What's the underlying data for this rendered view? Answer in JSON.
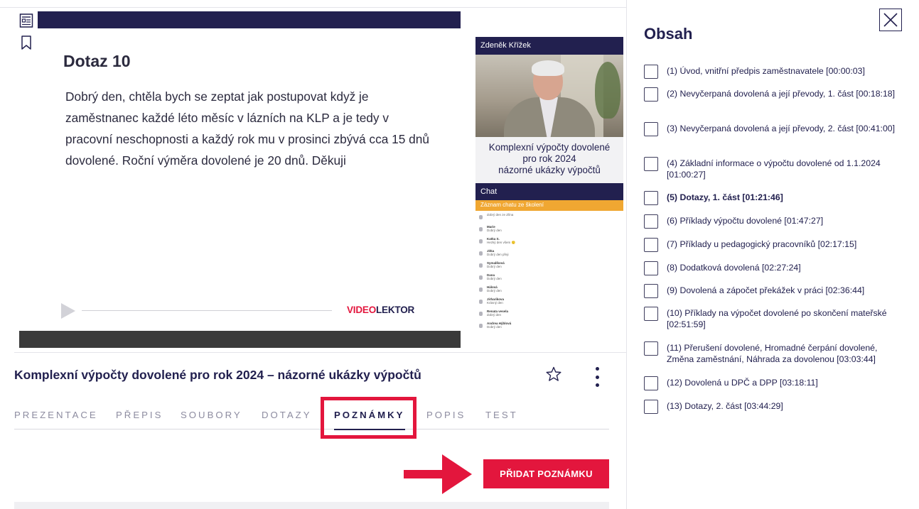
{
  "colors": {
    "brand_navy": "#22204f",
    "accent_red": "#e3163d",
    "chat_orange": "#f0a732"
  },
  "rail": {
    "icons": [
      "transcript-icon",
      "bookmark-icon"
    ]
  },
  "player": {
    "slide_title": "Dotaz 10",
    "slide_text": "Dobrý den, chtěla bych se zeptat jak postupovat když je zaměstnanec každé léto měsíc v lázních na KLP a je tedy v pracovní neschopnosti a každý rok mu v prosinci zbývá cca 15 dnů dovolené. Roční výměra dovolené je 20 dnů. Děkuji",
    "logo_part1": "VIDEO",
    "logo_part2": "LEKTOR",
    "speaker_name": "Zdeněk Křížek",
    "speaker_title_line1": "Komplexní výpočty dovolené",
    "speaker_title_line2": "pro rok 2024",
    "speaker_title_line3": "názorné ukázky výpočtů",
    "chat_label": "Chat",
    "chat_subheader": "Záznam chatu ze školení",
    "chat_messages": [
      {
        "name": "",
        "text": "dobrý den ze Zlína"
      },
      {
        "name": "Marie",
        "text": "Dobrý den"
      },
      {
        "name": "Katka S.",
        "text": "Hezký den všem 🙂"
      },
      {
        "name": "Jitka",
        "text": "Dobrý den přeji"
      },
      {
        "name": "Symalíková",
        "text": "Dobrý den"
      },
      {
        "name": "Dana",
        "text": "Dobrý den"
      },
      {
        "name": "Hálová",
        "text": "Dobrý den"
      },
      {
        "name": "Jirharikova",
        "text": "Krásný den"
      },
      {
        "name": "Renata vesela",
        "text": "dobrý den"
      },
      {
        "name": "Andrea Hýblová",
        "text": "Dobrý den"
      }
    ]
  },
  "course": {
    "title": "Komplexní výpočty dovolené pro rok 2024 – názorné ukázky výpočtů"
  },
  "tabs": [
    {
      "label": "PREZENTACE",
      "active": false
    },
    {
      "label": "PŘEPIS",
      "active": false
    },
    {
      "label": "SOUBORY",
      "active": false
    },
    {
      "label": "DOTAZY",
      "active": false
    },
    {
      "label": "POZNÁMKY",
      "active": true
    },
    {
      "label": "POPIS",
      "active": false
    },
    {
      "label": "TEST",
      "active": false
    }
  ],
  "notes": {
    "add_button_label": "PŘIDAT POZNÁMKU"
  },
  "drawer": {
    "title": "Obsah",
    "items": [
      {
        "label": "(1) Úvod, vnitřní předpis zaměstnavatele [00:00:03]",
        "current": false
      },
      {
        "label": "(2) Nevyčerpaná dovolená a její převody, 1. část [00:18:18]",
        "current": false
      },
      {
        "label": "(3) Nevyčerpaná dovolená a její převody, 2. část [00:41:00]",
        "current": false
      },
      {
        "label": "(4) Základní informace o výpočtu dovolené od 1.1.2024 [01:00:27]",
        "current": false
      },
      {
        "label": "(5) Dotazy, 1. část [01:21:46]",
        "current": true
      },
      {
        "label": "(6) Příklady výpočtu dovolené [01:47:27]",
        "current": false
      },
      {
        "label": "(7) Příklady u pedagogický pracovníků [02:17:15]",
        "current": false
      },
      {
        "label": "(8) Dodatková dovolená [02:27:24]",
        "current": false
      },
      {
        "label": "(9) Dovolená a zápočet překážek v práci [02:36:44]",
        "current": false
      },
      {
        "label": "(10) Příklady na výpočet dovolené po skončení mateřské [02:51:59]",
        "current": false
      },
      {
        "label": "(11) Přerušení dovolené, Hromadné čerpání dovolené, Změna zaměstnání, Náhrada za dovolenou [03:03:44]",
        "current": false
      },
      {
        "label": "(12) Dovolená u DPČ a DPP [03:18:11]",
        "current": false
      },
      {
        "label": "(13) Dotazy, 2. část [03:44:29]",
        "current": false
      }
    ]
  }
}
